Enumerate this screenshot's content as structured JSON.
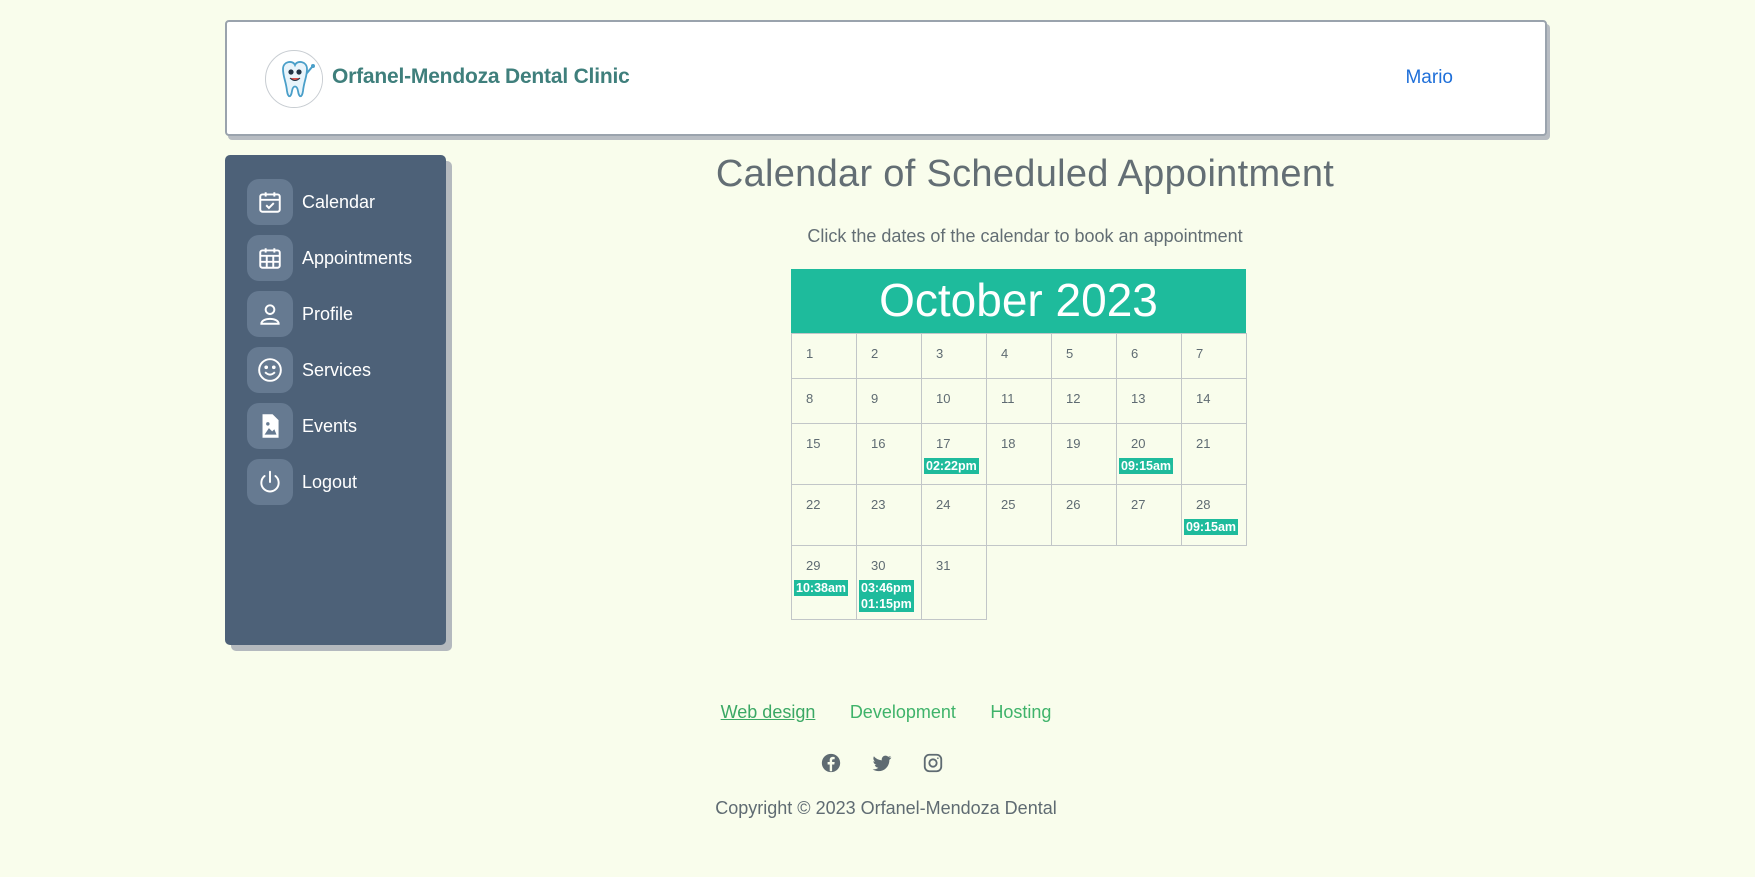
{
  "header": {
    "brand": "Orfanel-Mendoza Dental Clinic",
    "user": "Mario",
    "logo_icon": "tooth-mascot-logo"
  },
  "sidebar": {
    "items": [
      {
        "label": "Calendar",
        "icon": "calendar-check-icon"
      },
      {
        "label": "Appointments",
        "icon": "calendar-grid-icon"
      },
      {
        "label": "Profile",
        "icon": "user-icon"
      },
      {
        "label": "Services",
        "icon": "smile-icon"
      },
      {
        "label": "Events",
        "icon": "image-icon"
      },
      {
        "label": "Logout",
        "icon": "power-icon"
      }
    ]
  },
  "main": {
    "title": "Calendar of Scheduled Appointment",
    "subtitle": "Click the dates of the calendar to book an appointment"
  },
  "calendar": {
    "month_title": "October 2023",
    "days": [
      {
        "day": "1",
        "appointments": []
      },
      {
        "day": "2",
        "appointments": []
      },
      {
        "day": "3",
        "appointments": []
      },
      {
        "day": "4",
        "appointments": []
      },
      {
        "day": "5",
        "appointments": []
      },
      {
        "day": "6",
        "appointments": []
      },
      {
        "day": "7",
        "appointments": []
      },
      {
        "day": "8",
        "appointments": []
      },
      {
        "day": "9",
        "appointments": []
      },
      {
        "day": "10",
        "appointments": []
      },
      {
        "day": "11",
        "appointments": []
      },
      {
        "day": "12",
        "appointments": []
      },
      {
        "day": "13",
        "appointments": []
      },
      {
        "day": "14",
        "appointments": []
      },
      {
        "day": "15",
        "appointments": []
      },
      {
        "day": "16",
        "appointments": []
      },
      {
        "day": "17",
        "appointments": [
          "02:22pm"
        ]
      },
      {
        "day": "18",
        "appointments": []
      },
      {
        "day": "19",
        "appointments": []
      },
      {
        "day": "20",
        "appointments": [
          "09:15am"
        ]
      },
      {
        "day": "21",
        "appointments": []
      },
      {
        "day": "22",
        "appointments": []
      },
      {
        "day": "23",
        "appointments": []
      },
      {
        "day": "24",
        "appointments": []
      },
      {
        "day": "25",
        "appointments": []
      },
      {
        "day": "26",
        "appointments": []
      },
      {
        "day": "27",
        "appointments": []
      },
      {
        "day": "28",
        "appointments": [
          "09:15am"
        ]
      },
      {
        "day": "29",
        "appointments": [
          "10:38am"
        ]
      },
      {
        "day": "30",
        "appointments": [
          "03:46pm",
          "01:15pm"
        ]
      },
      {
        "day": "31",
        "appointments": []
      }
    ]
  },
  "footer": {
    "links": [
      "Web design",
      "Development",
      "Hosting"
    ],
    "social": [
      "facebook-icon",
      "twitter-icon",
      "instagram-icon"
    ],
    "copyright": "Copyright © 2023 Orfanel-Mendoza Dental"
  },
  "colors": {
    "accent": "#1ebb9c",
    "sidebar": "#4d6178",
    "link": "#1e6fd9",
    "footer_link": "#3fb36a",
    "background": "#f9fdec"
  }
}
